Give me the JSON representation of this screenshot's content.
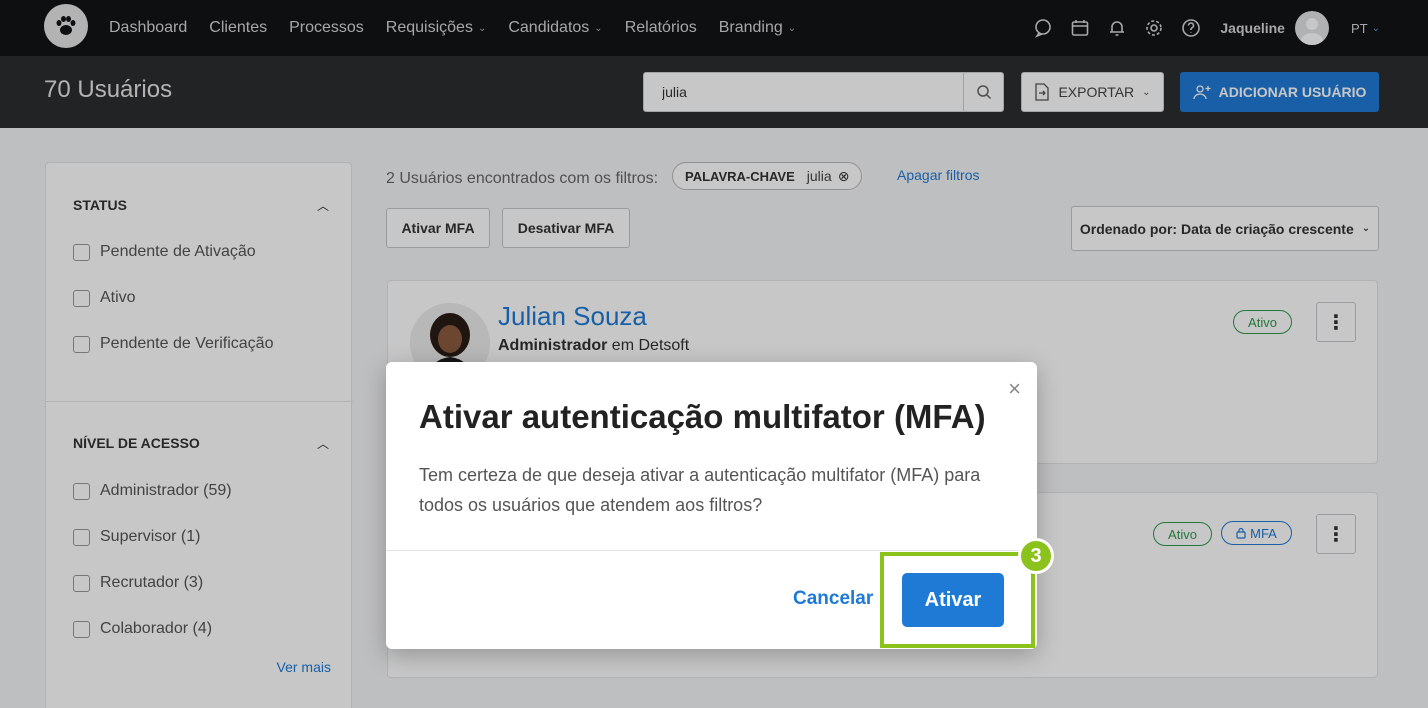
{
  "nav": {
    "links": [
      {
        "label": "Dashboard",
        "dropdown": false
      },
      {
        "label": "Clientes",
        "dropdown": false
      },
      {
        "label": "Processos",
        "dropdown": false
      },
      {
        "label": "Requisições",
        "dropdown": true
      },
      {
        "label": "Candidatos",
        "dropdown": true
      },
      {
        "label": "Relatórios",
        "dropdown": false
      },
      {
        "label": "Branding",
        "dropdown": true
      }
    ],
    "user_name": "Jaqueline",
    "language": "PT"
  },
  "header": {
    "title": "70 Usuários",
    "search_value": "julia",
    "export_label": "EXPORTAR",
    "add_user_label": "ADICIONAR USUÁRIO"
  },
  "sidebar": {
    "status": {
      "title": "STATUS",
      "items": [
        "Pendente de Ativação",
        "Ativo",
        "Pendente de Verificação"
      ]
    },
    "access": {
      "title": "NÍVEL DE ACESSO",
      "items": [
        "Administrador (59)",
        "Supervisor (1)",
        "Recrutador (3)",
        "Colaborador (4)"
      ]
    },
    "see_more": "Ver mais"
  },
  "main": {
    "found_text": "2 Usuários encontrados com os filtros:",
    "chip_label": "PALAVRA-CHAVE",
    "chip_value": "julia",
    "clear_filters": "Apagar filtros",
    "activate_mfa": "Ativar MFA",
    "deactivate_mfa": "Desativar MFA",
    "sort_label": "Ordenado por: Data de criação crescente",
    "users": [
      {
        "name": "Julian Souza",
        "role": "Administrador",
        "connector": "em",
        "company": "Detsoft",
        "badges": [
          "Ativo"
        ]
      },
      {
        "badges": [
          "Ativo",
          "MFA"
        ]
      }
    ]
  },
  "modal": {
    "title": "Ativar autenticação multifator (MFA)",
    "body": "Tem certeza de que deseja ativar a autenticação multifator (MFA) para todos os usuários que atendem aos filtros?",
    "cancel": "Cancelar",
    "confirm": "Ativar"
  },
  "annotation": {
    "step": "3"
  },
  "colors": {
    "primary": "#1f7ad6",
    "success": "#2f9a4c",
    "highlight": "#8cc21c",
    "nav_bg": "#121416",
    "header_bg": "#2b2d30"
  }
}
